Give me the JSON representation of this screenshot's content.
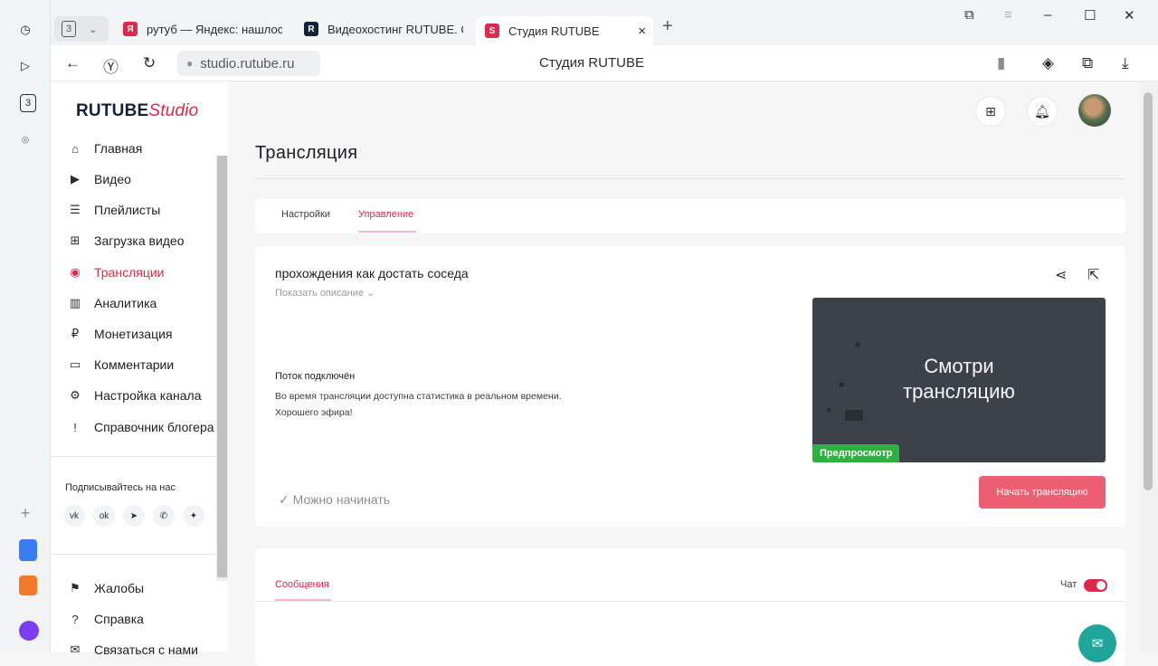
{
  "browser": {
    "tab_count": "3",
    "tabs": [
      {
        "title": "рутуб — Яндекс: нашлось",
        "favicon": "Я",
        "color": "#e0284c"
      },
      {
        "title": "Видеохостинг RUTUBE. С",
        "favicon": "R",
        "color": "#16223a"
      },
      {
        "title": "Студия RUTUBE",
        "favicon": "S",
        "color": "#e0284c"
      }
    ],
    "url": "studio.rutube.ru",
    "page_title": "Студия RUTUBE"
  },
  "app": {
    "logo_main": "RUTUBE",
    "logo_suffix": "Studio",
    "nav": [
      {
        "label": "Главная",
        "icon": "home-icon",
        "glyph": "⌂"
      },
      {
        "label": "Видео",
        "icon": "video-icon",
        "glyph": "▶"
      },
      {
        "label": "Плейлисты",
        "icon": "playlist-icon",
        "glyph": "☰"
      },
      {
        "label": "Загрузка видео",
        "icon": "upload-icon",
        "glyph": "⊞"
      },
      {
        "label": "Трансляции",
        "icon": "broadcast-icon",
        "glyph": "◉"
      },
      {
        "label": "Аналитика",
        "icon": "analytics-icon",
        "glyph": "▥"
      },
      {
        "label": "Монетизация",
        "icon": "monetization-icon",
        "glyph": "₽"
      },
      {
        "label": "Комментарии",
        "icon": "comments-icon",
        "glyph": "▭"
      },
      {
        "label": "Настройка канала",
        "icon": "settings-icon",
        "glyph": "⚙"
      },
      {
        "label": "Справочник блогера",
        "icon": "guide-icon",
        "glyph": "!"
      }
    ],
    "subscribe_label": "Подписывайтесь на нас",
    "social": [
      "vk-icon",
      "ok-icon",
      "telegram-icon",
      "viber-icon",
      "more-icon"
    ],
    "bottom_nav": [
      {
        "label": "Жалобы",
        "icon": "flag-icon",
        "glyph": "⚑"
      },
      {
        "label": "Справка",
        "icon": "help-icon",
        "glyph": "?"
      },
      {
        "label": "Связаться с нами",
        "icon": "mail-icon",
        "glyph": "✉"
      }
    ]
  },
  "main": {
    "heading": "Трансляция",
    "tabs": [
      "Настройки",
      "Управление"
    ],
    "stream": {
      "title": "прохождения как достать соседа",
      "show_description": "Показать описание",
      "status_title": "Поток подключён",
      "status_line1": "Во время трансляции доступна статистика в реальном времени.",
      "status_line2": "Хорошего эфира!",
      "preview_line1": "Смотри",
      "preview_line2": "трансляцию",
      "preview_badge": "Предпросмотр",
      "ready_text": "Можно начинать",
      "start_button": "Начать трансляцию"
    },
    "chat": {
      "messages_tab": "Сообщения",
      "chat_label": "Чат",
      "chat_enabled": true
    }
  }
}
